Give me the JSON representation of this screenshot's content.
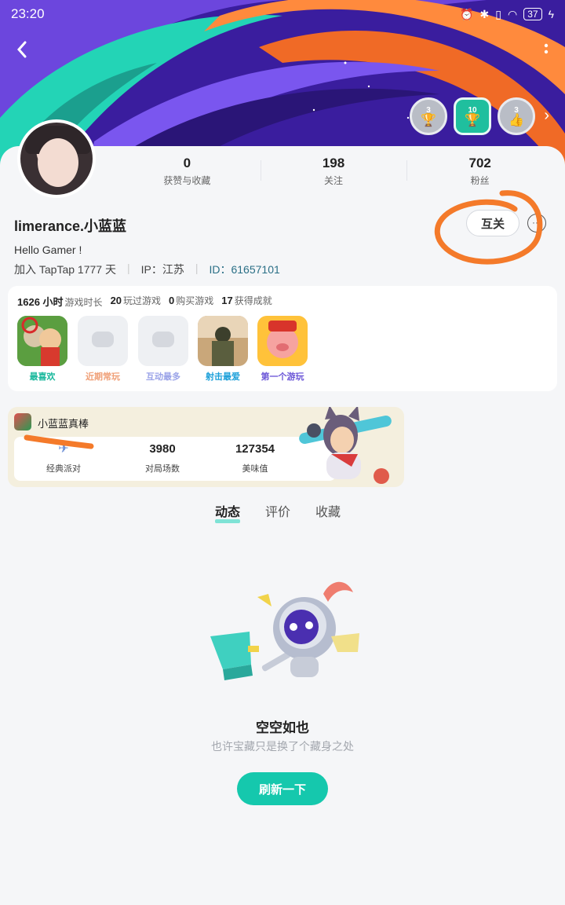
{
  "status_bar": {
    "time": "23:20",
    "battery": "37"
  },
  "badges": [
    {
      "num": "3",
      "icon": "trophy-icon",
      "style": "gray"
    },
    {
      "num": "10",
      "icon": "trophy-icon",
      "style": "green"
    },
    {
      "num": "3",
      "icon": "thumbs-up-icon",
      "style": "gray"
    }
  ],
  "stats": [
    {
      "value": "0",
      "label": "获赞与收藏"
    },
    {
      "value": "198",
      "label": "关注"
    },
    {
      "value": "702",
      "label": "粉丝"
    }
  ],
  "profile": {
    "username": "limerance.小蓝蓝",
    "follow_label": "互关",
    "bio": "Hello Gamer !",
    "joined": "加入 TapTap 1777 天",
    "ip": "IP：江苏",
    "id_label": "ID：",
    "id_value": "61657101"
  },
  "games_summary": [
    {
      "value": "1626 小时",
      "label": "游戏时长"
    },
    {
      "value": "20",
      "label": "玩过游戏"
    },
    {
      "value": "0",
      "label": "购买游戏"
    },
    {
      "value": "17",
      "label": "获得成就"
    }
  ],
  "game_tiles": [
    {
      "label": "最喜欢",
      "color": "#19b89c"
    },
    {
      "label": "近期常玩",
      "color": "#f0a078"
    },
    {
      "label": "互动最多",
      "color": "#9aa3e8"
    },
    {
      "label": "射击最爱",
      "color": "#1a9fd9"
    },
    {
      "label": "第一个游玩",
      "color": "#6c57d8"
    }
  ],
  "party": {
    "title": "小蓝蓝真棒",
    "cols": [
      {
        "value": "",
        "label": "经典派对"
      },
      {
        "value": "3980",
        "label": "对局场数"
      },
      {
        "value": "127354",
        "label": "美味值"
      }
    ]
  },
  "tabs": [
    "动态",
    "评价",
    "收藏"
  ],
  "empty": {
    "title": "空空如也",
    "subtitle": "也许宝藏只是换了个藏身之处",
    "button": "刷新一下"
  },
  "colors": {
    "accent": "#15c8ad",
    "annotation": "#f47a2a"
  }
}
